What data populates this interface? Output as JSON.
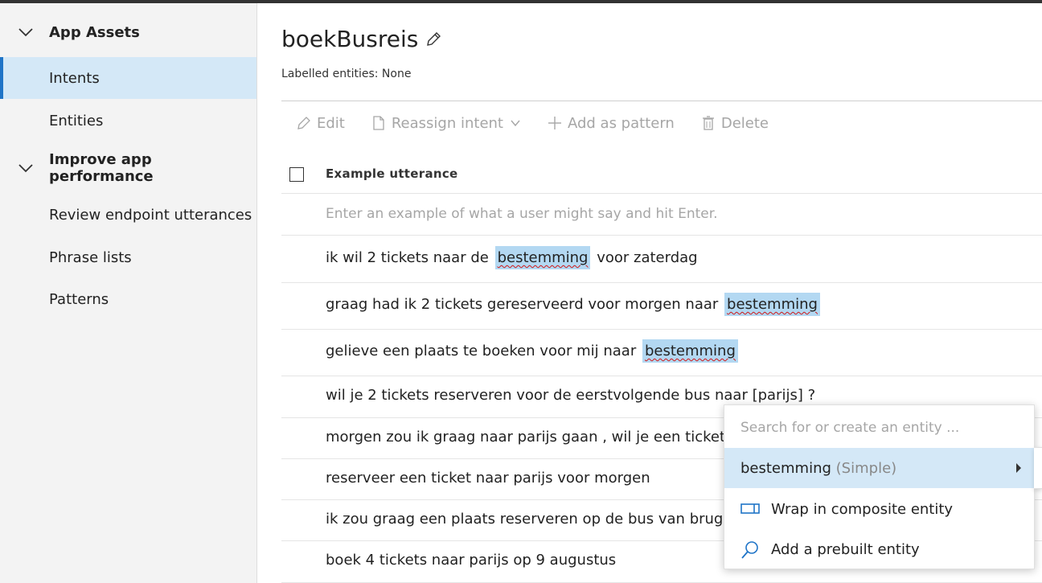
{
  "sidebar": {
    "groups": [
      {
        "label": "App Assets",
        "items": [
          {
            "label": "Intents",
            "selected": true
          },
          {
            "label": "Entities"
          }
        ]
      },
      {
        "label": "Improve app performance",
        "items": [
          {
            "label": "Review endpoint utterances"
          },
          {
            "label": "Phrase lists"
          },
          {
            "label": "Patterns"
          }
        ]
      }
    ]
  },
  "intent": {
    "title": "boekBusreis",
    "labelled_entities": "Labelled entities: None"
  },
  "toolbar": {
    "edit": "Edit",
    "reassign": "Reassign intent",
    "add_pattern": "Add as pattern",
    "delete": "Delete"
  },
  "table": {
    "column_header": "Example utterance",
    "input_placeholder": "Enter an example of what a user might say and hit Enter.",
    "utterances": [
      {
        "before": "ik wil 2 tickets naar de",
        "entity": "bestemming",
        "after": "voor zaterdag"
      },
      {
        "before": "graag had ik 2 tickets gereserveerd voor morgen naar",
        "entity": "bestemming",
        "after": ""
      },
      {
        "before": "gelieve een plaats te boeken voor mij naar",
        "entity": "bestemming",
        "after": ""
      },
      {
        "before": "wil je 2 tickets reserveren voor de eerstvolgende bus naar [parijs] ?",
        "entity": "",
        "after": ""
      },
      {
        "before": "morgen zou ik graag naar parijs gaan , wil je een ticket res",
        "entity": "",
        "after": ""
      },
      {
        "before": "reserveer een ticket naar parijs voor morgen",
        "entity": "",
        "after": ""
      },
      {
        "before": "ik zou graag een plaats reserveren op de bus van brugge n",
        "entity": "",
        "after": ""
      },
      {
        "before": "boek 4 tickets naar parijs op 9 augustus",
        "entity": "",
        "after": ""
      }
    ]
  },
  "entity_menu": {
    "search_placeholder": "Search for or create an entity ...",
    "suggestion_name": "bestemming",
    "suggestion_type": "(Simple)",
    "wrap": "Wrap in composite entity",
    "prebuilt": "Add a prebuilt entity",
    "icon_wrap": "composite-entity-icon",
    "icon_prebuilt": "search-icon"
  },
  "colors": {
    "selected_bg": "#d4e8f7",
    "accent": "#1f74c7",
    "entity_highlight": "#b3d8f2",
    "spell_underline": "#d01818"
  }
}
